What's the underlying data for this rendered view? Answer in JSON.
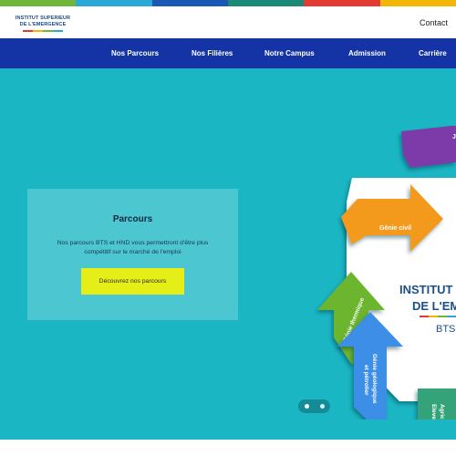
{
  "top_strip_colors": [
    "#6fb63a",
    "#2aa8d6",
    "#1b57b5",
    "#1a8a78",
    "#e53935",
    "#f2b705"
  ],
  "header": {
    "logo_line1": "INSTITUT SUPERIEUR",
    "logo_line2": "DE L'EMERGENCE",
    "logo_bar_colors": [
      "#e53935",
      "#f2b705",
      "#6fb63a",
      "#2aa8d6"
    ],
    "contact_label": "Contact"
  },
  "nav": {
    "items": [
      {
        "label": "Nos Parcours"
      },
      {
        "label": "Nos Filières"
      },
      {
        "label": "Notre Campus"
      },
      {
        "label": "Admission"
      },
      {
        "label": "Carrière"
      }
    ]
  },
  "hero": {
    "background": "#1ab6c4",
    "card": {
      "title": "Parcours",
      "text": "Nos parcours BTS et HND vous permettront d'être plus compétitif sur le marché de l'emploi",
      "button_label": "Découvrez nos parcours"
    },
    "graphic": {
      "title_line1": "INSTITUT",
      "title_line2": "DE L'EM",
      "subtitle": "BTS",
      "arrows": [
        {
          "label": "Génie civil",
          "color": "#f39a1c"
        },
        {
          "label": "Génie thermique",
          "color": "#6cb52d"
        },
        {
          "label": "Génie géologique et pétrolier",
          "color": "#3d8ee6"
        },
        {
          "label": "Agric Eleve",
          "color": "#35a37a"
        },
        {
          "label": "J",
          "color": "#7c3aa8"
        }
      ]
    },
    "carousel": {
      "slide_count": 2,
      "active_index": 1
    }
  }
}
